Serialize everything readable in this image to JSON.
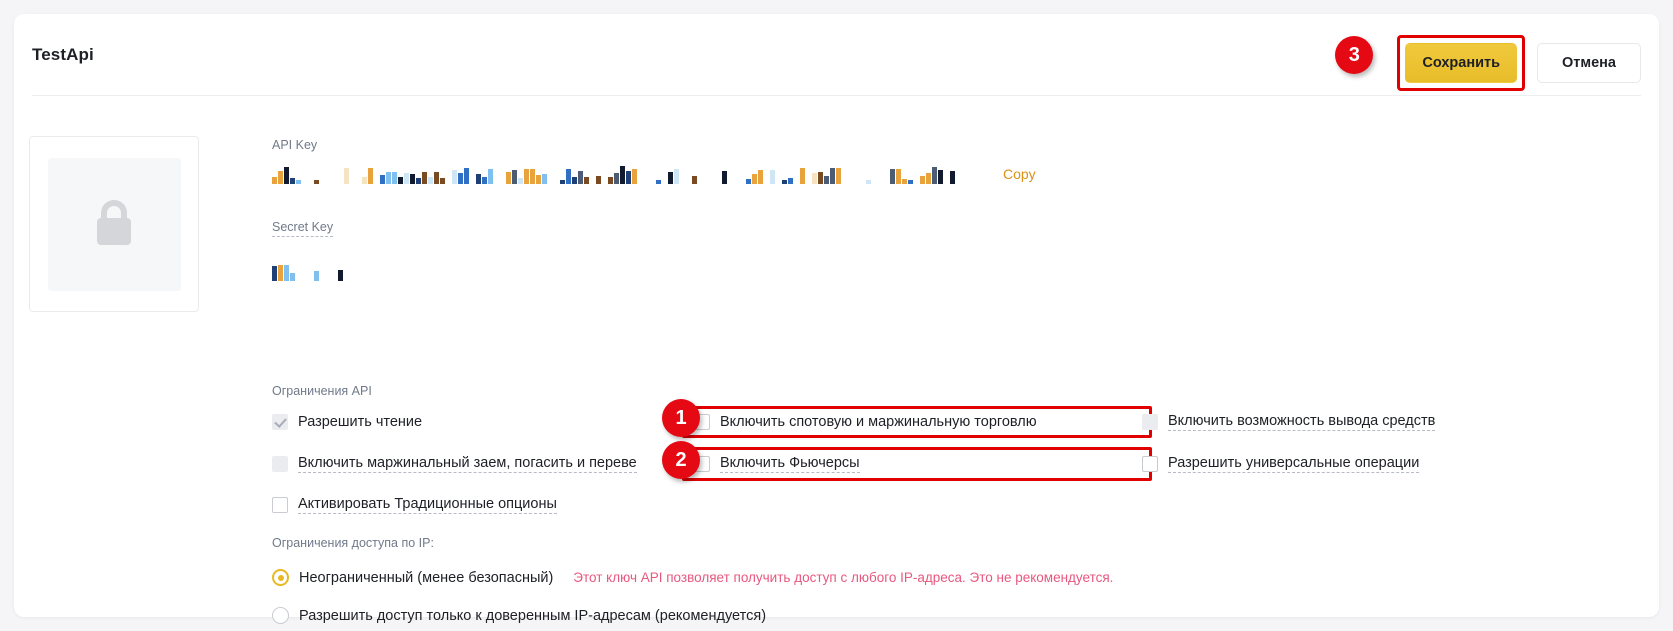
{
  "header": {
    "title": "TestApi",
    "save_label": "Сохранить",
    "cancel_label": "Отмена"
  },
  "badges": {
    "one": "1",
    "two": "2",
    "three": "3"
  },
  "avatar": {
    "icon": "lock-icon"
  },
  "fields": {
    "api_key_label": "API Key",
    "api_key_value": "",
    "copy_label": "Copy",
    "secret_key_label": "Secret Key",
    "secret_key_value": ""
  },
  "permissions": {
    "section_label": "Ограничения API",
    "items": [
      {
        "label": "Разрешить чтение",
        "checked": true,
        "disabled": true,
        "dotted": false,
        "highlight": false
      },
      {
        "label": "Включить спотовую и маржинальную торговлю",
        "checked": false,
        "disabled": false,
        "dotted": false,
        "highlight": true
      },
      {
        "label": "Включить возможность вывода средств",
        "checked": false,
        "disabled": true,
        "dotted": true,
        "highlight": false
      },
      {
        "label": "Включить маржинальный заем, погасить и переве",
        "checked": false,
        "disabled": true,
        "dotted": true,
        "highlight": false
      },
      {
        "label": "Включить Фьючерсы",
        "checked": false,
        "disabled": false,
        "dotted": true,
        "highlight": true
      },
      {
        "label": "Разрешить универсальные операции",
        "checked": false,
        "disabled": false,
        "dotted": true,
        "highlight": false
      },
      {
        "label": "Активировать Традиционные опционы",
        "checked": false,
        "disabled": false,
        "dotted": true,
        "highlight": false
      }
    ]
  },
  "ip": {
    "section_label": "Ограничения доступа по IP:",
    "option_unrestricted": "Неограниченный (менее безопасный)",
    "warning": "Этот ключ API позволяет получить доступ с любого IP-адреса. Это не рекомендуется.",
    "option_trusted": "Разрешить доступ только к доверенным IP-адресам (рекомендуется)"
  },
  "colors": {
    "accent": "#e8b923",
    "save_button": "#ecc94b",
    "highlight": "#e00000",
    "badge": "#e50914",
    "warning_text": "#e8577f",
    "copy_link": "#d99118"
  }
}
